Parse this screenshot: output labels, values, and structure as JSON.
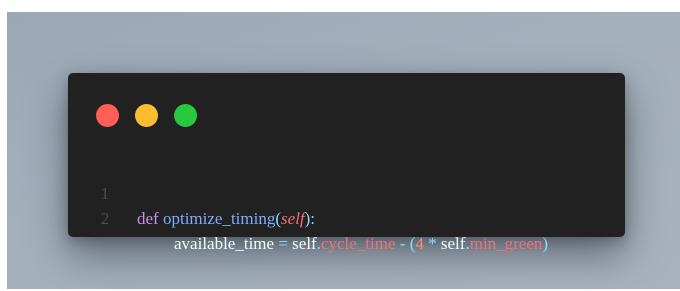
{
  "window": {
    "controls": [
      {
        "name": "close",
        "color": "#ff5f57"
      },
      {
        "name": "minimize",
        "color": "#febc2e"
      },
      {
        "name": "zoom",
        "color": "#28c840"
      }
    ]
  },
  "code": {
    "lines": [
      {
        "number": "1",
        "tokens": [
          {
            "type": "keyword",
            "text": "def"
          },
          {
            "type": "plain",
            "text": " "
          },
          {
            "type": "func",
            "text": "optimize_timing"
          },
          {
            "type": "punct",
            "text": "("
          },
          {
            "type": "self-italic",
            "text": "self"
          },
          {
            "type": "punct",
            "text": "):"
          }
        ]
      },
      {
        "number": "2",
        "tokens": [
          {
            "type": "plain",
            "text": "available_time"
          },
          {
            "type": "plain",
            "text": " "
          },
          {
            "type": "op",
            "text": "="
          },
          {
            "type": "plain",
            "text": " "
          },
          {
            "type": "plain",
            "text": "self"
          },
          {
            "type": "punct",
            "text": "."
          },
          {
            "type": "attr",
            "text": "cycle_time"
          },
          {
            "type": "plain",
            "text": " "
          },
          {
            "type": "op",
            "text": "-"
          },
          {
            "type": "plain",
            "text": " "
          },
          {
            "type": "punct",
            "text": "("
          },
          {
            "type": "num",
            "text": "4"
          },
          {
            "type": "plain",
            "text": " "
          },
          {
            "type": "op",
            "text": "*"
          },
          {
            "type": "plain",
            "text": " "
          },
          {
            "type": "plain",
            "text": "self"
          },
          {
            "type": "punct",
            "text": "."
          },
          {
            "type": "attr",
            "text": "min_green"
          },
          {
            "type": "punct",
            "text": ")"
          }
        ]
      }
    ]
  }
}
